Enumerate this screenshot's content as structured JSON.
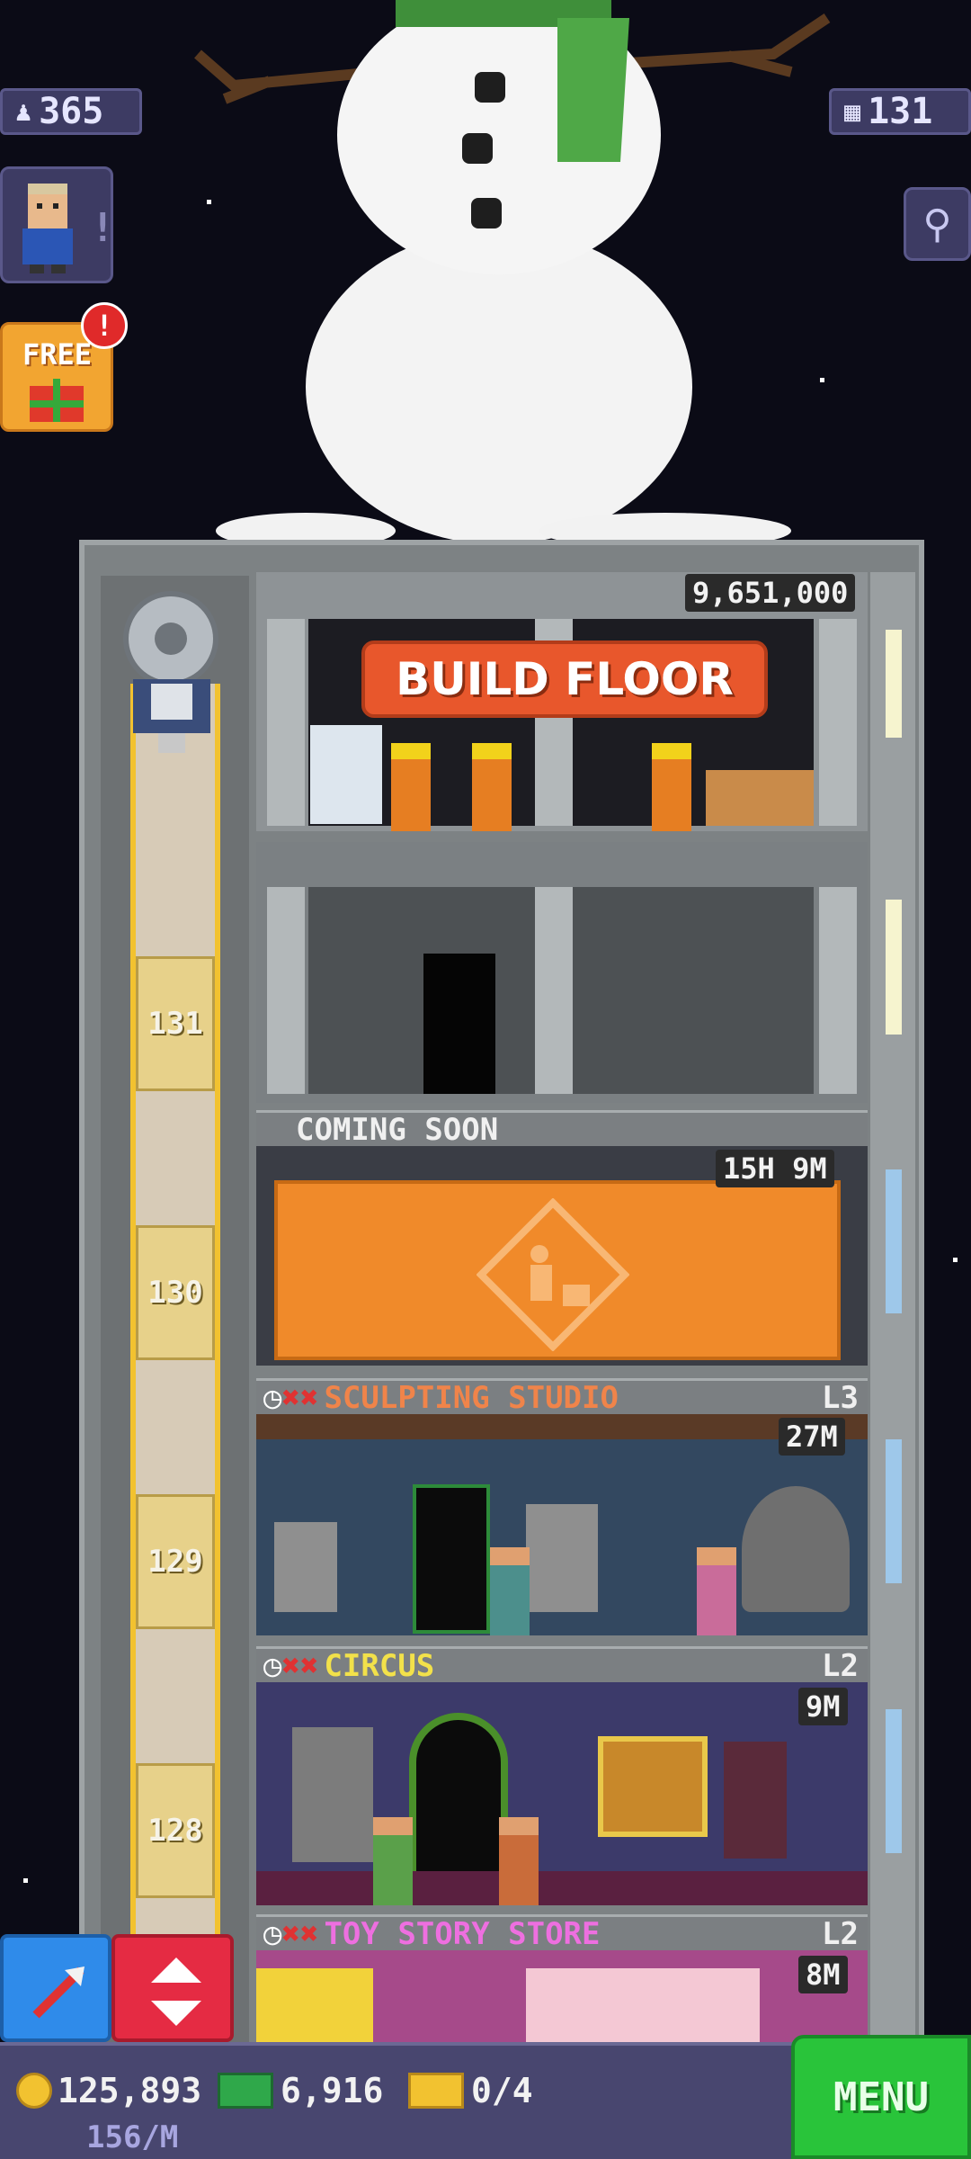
{
  "top": {
    "population": "365",
    "floors": "131"
  },
  "side": {
    "free_label": "FREE",
    "alert": "!"
  },
  "build": {
    "cost": "9,651,000",
    "button": "BUILD FLOOR"
  },
  "coming_soon": {
    "label": "COMING SOON",
    "timer": "15H 9M"
  },
  "elevator_numbers": [
    "131",
    "130",
    "129",
    "128"
  ],
  "floors": [
    {
      "name": "SCULPTING STUDIO",
      "level": "L3",
      "time": "27M",
      "name_color": "#f0844a"
    },
    {
      "name": "CIRCUS",
      "level": "L2",
      "time": "9M",
      "name_color": "#f2e14a"
    },
    {
      "name": "TOY STORY STORE",
      "level": "L2",
      "time": "8M",
      "name_color": "#ee6fe0"
    }
  ],
  "bottom": {
    "coins": "125,893",
    "coins_rate": "156/M",
    "bux": "6,916",
    "tickets": "0/4",
    "menu": "MENU"
  },
  "colors": {
    "sky": "#0b0b16",
    "build_btn": "#e8572c",
    "menu_btn": "#29c43a",
    "elevator_btn": "#e52b43",
    "vip_btn": "#2f8bea"
  }
}
